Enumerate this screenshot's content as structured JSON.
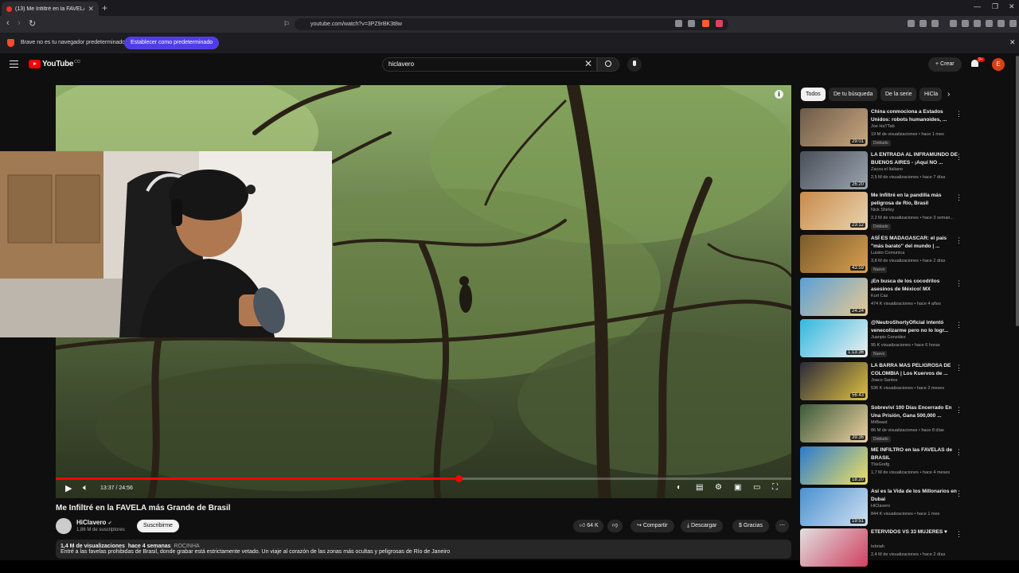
{
  "browser": {
    "tab_title": "(13) Me Infiltré en la FAVELA más...",
    "url": "youtube.com/watch?v=3PZ9rBK3t8w",
    "infobar_message": "Brave no es tu navegador predeterminado",
    "infobar_button": "Establecer como predeterminado"
  },
  "header": {
    "logo": "YouTube",
    "logo_region": "CO",
    "search_value": "hiclavero",
    "create_label": "Crear",
    "notifications_badge": "9+",
    "avatar_letter": "E"
  },
  "player": {
    "time": "13:37 / 24:56",
    "progress_fraction": 0.548
  },
  "video": {
    "title": "Me Infiltré en la FAVELA más Grande de Brasil",
    "channel": "HiClavero",
    "subscribers": "1,86 M de suscriptores",
    "subscribe_label": "Suscribirme",
    "likes": "64 K",
    "share_label": "Compartir",
    "download_label": "Descargar",
    "thanks_label": "Gracias",
    "views": "1,4 M de visualizaciones",
    "posted": "hace 4 semanas",
    "tag": "ROCINHA",
    "description": "Entré a las favelas prohibidas de Brasil, donde grabar está estrictamente vetado. Un viaje al corazón de las zonas más ocultas y peligrosas de Río de Janeiro"
  },
  "chips": [
    "Todos",
    "De tu búsqueda",
    "De la serie",
    "HiCla"
  ],
  "recommendations": [
    {
      "title": "China conmociona a Estados Unidos: robots humanoides, ...",
      "channel": "Joe HaTTab",
      "meta": "19 M de visualizaciones • hace 1 mes",
      "badge": "Doblado",
      "duration": "29:01",
      "colors": [
        "#6c5a48",
        "#c9a880"
      ]
    },
    {
      "title": "LA ENTRADA AL INFRAMUNDO DE BUENOS AIRES - ¡Aquí NO ...",
      "channel": "Zazza el Italiano",
      "meta": "2,5 M de visualizaciones • hace 7 días",
      "badge": "",
      "duration": "26:20",
      "colors": [
        "#4a4f58",
        "#9aa4b0"
      ]
    },
    {
      "title": "Me Infiltré en la pandilla más peligrosa de Río, Brasil",
      "channel": "Nick Shirley",
      "meta": "2,2 M de visualizaciones • hace 3 seman...",
      "badge": "Doblado",
      "duration": "23:12",
      "colors": [
        "#c98a4a",
        "#e8d4b0"
      ]
    },
    {
      "title": "ASÍ ES MADAGASCAR: el país \"más barato\" del mundo | ...",
      "channel": "Luisito Comunica",
      "meta": "3,8 M de visualizaciones • hace 2 días",
      "badge": "Nuevo",
      "duration": "43:59",
      "colors": [
        "#7a5a2a",
        "#d8a050"
      ]
    },
    {
      "title": "¡En busca de los cocodrilos asesinos de México! MX",
      "channel": "Kurt Caz",
      "meta": "474 K visualizaciones • hace 4 años",
      "badge": "",
      "duration": "24:24",
      "colors": [
        "#5aa0d8",
        "#e8c890"
      ]
    },
    {
      "title": "@NeutroShortyOficial intentó venecolizarme pero no lo logr...",
      "channel": "Juanpis González",
      "meta": "95 K visualizaciones • hace 6 horas",
      "badge": "Nuevo",
      "duration": "1:13:36",
      "colors": [
        "#30b8e0",
        "#f0f0f0"
      ]
    },
    {
      "title": "LA BARRA MAS PELIGROSA DE COLOMBIA | Los Kuervos de ...",
      "channel": "Joaco Santos",
      "meta": "536 K visualizaciones • hace 2 meses",
      "badge": "",
      "duration": "56:43",
      "colors": [
        "#2a2a3a",
        "#e0c040"
      ]
    },
    {
      "title": "Sobreviví 100 Días Encerrado En Una Prisión, Gana 500,000 ...",
      "channel": "MrBeast",
      "meta": "86 M de visualizaciones • hace 8 días",
      "badge": "Doblado",
      "duration": "39:36",
      "colors": [
        "#3a5a3a",
        "#f0d0a0"
      ]
    },
    {
      "title": "ME INFILTRO en las FAVELAS de BRASIL",
      "channel": "TheGrefg",
      "meta": "1,7 M de visualizaciones • hace 4 meses",
      "badge": "",
      "duration": "18:20",
      "colors": [
        "#2a7ad0",
        "#f0e060"
      ]
    },
    {
      "title": "Así es la Vida de los Millonarios en Dubai",
      "channel": "HiClavero",
      "meta": "844 K visualizaciones • hace 1 mes",
      "badge": "",
      "duration": "19:51",
      "colors": [
        "#4a90d0",
        "#d0e0f0"
      ]
    },
    {
      "title": "ETERVIDOS VS 33 MUJERES ♥",
      "channel": "Iebriah",
      "meta": "2,4 M de visualizaciones • hace 2 días",
      "badge": "",
      "duration": "",
      "colors": [
        "#e0e0e0",
        "#d04060"
      ]
    }
  ]
}
